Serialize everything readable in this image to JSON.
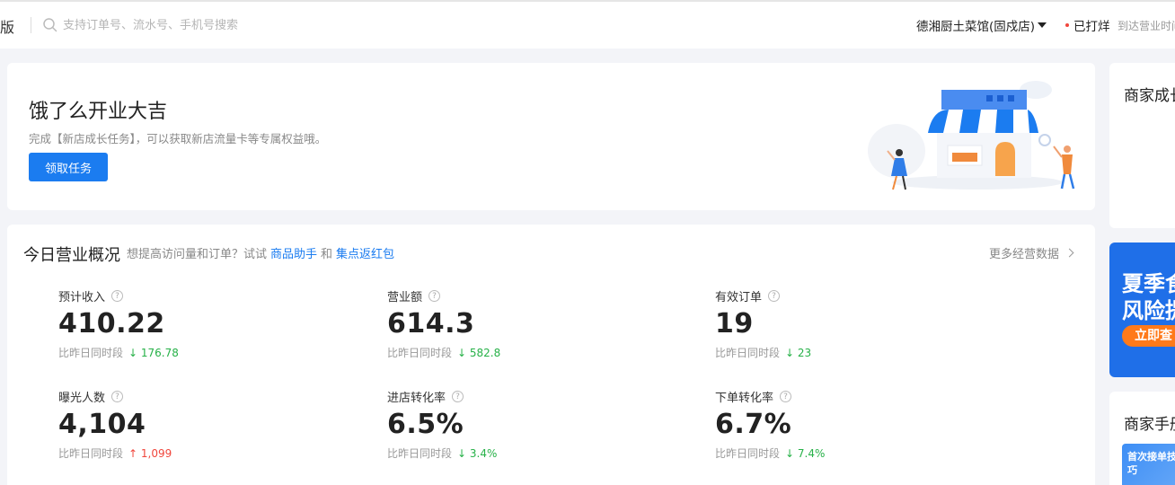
{
  "topbar": {
    "brand_fragment": "版",
    "search_placeholder": "支持订单号、流水号、手机号搜索",
    "store_name": "德湘厨土菜馆(固戍店)",
    "status": "已打烊",
    "status_sub": "到达营业时间"
  },
  "welcome": {
    "title": "饿了么开业大吉",
    "desc": "完成【新店成长任务】，可以获取新店流量卡等专属权益哦。",
    "button": "领取任务"
  },
  "overview": {
    "title": "今日营业概况",
    "hint_prefix": "想提高访问量和订单？试试",
    "link1": "商品助手",
    "hint_and": "和",
    "link2": "集点返红包",
    "more": "更多经营数据",
    "compare_label": "比昨日同时段",
    "metrics": [
      {
        "label": "预计收入",
        "value": "410.22",
        "delta": "↓ 176.78",
        "direction": "down"
      },
      {
        "label": "营业额",
        "value": "614.3",
        "delta": "↓ 582.8",
        "direction": "down"
      },
      {
        "label": "有效订单",
        "value": "19",
        "delta": "↓ 23",
        "direction": "down"
      },
      {
        "label": "曝光人数",
        "value": "4,104",
        "delta": "↑ 1,099",
        "direction": "up"
      },
      {
        "label": "进店转化率",
        "value": "6.5%",
        "delta": "↓ 3.4%",
        "direction": "down"
      },
      {
        "label": "下单转化率",
        "value": "6.7%",
        "delta": "↓ 7.4%",
        "direction": "down"
      }
    ]
  },
  "right": {
    "card1_title": "商家成长",
    "banner_line1": "夏季食",
    "banner_line2": "风险提",
    "banner_button": "立即查",
    "card3_title": "商家手册",
    "tip_text": "首次接单技巧"
  },
  "colors": {
    "primary": "#1b7cf0",
    "down": "#27b148",
    "up": "#f0463c",
    "banner": "#1f6fe8",
    "banner_button": "#ff7a1a"
  }
}
